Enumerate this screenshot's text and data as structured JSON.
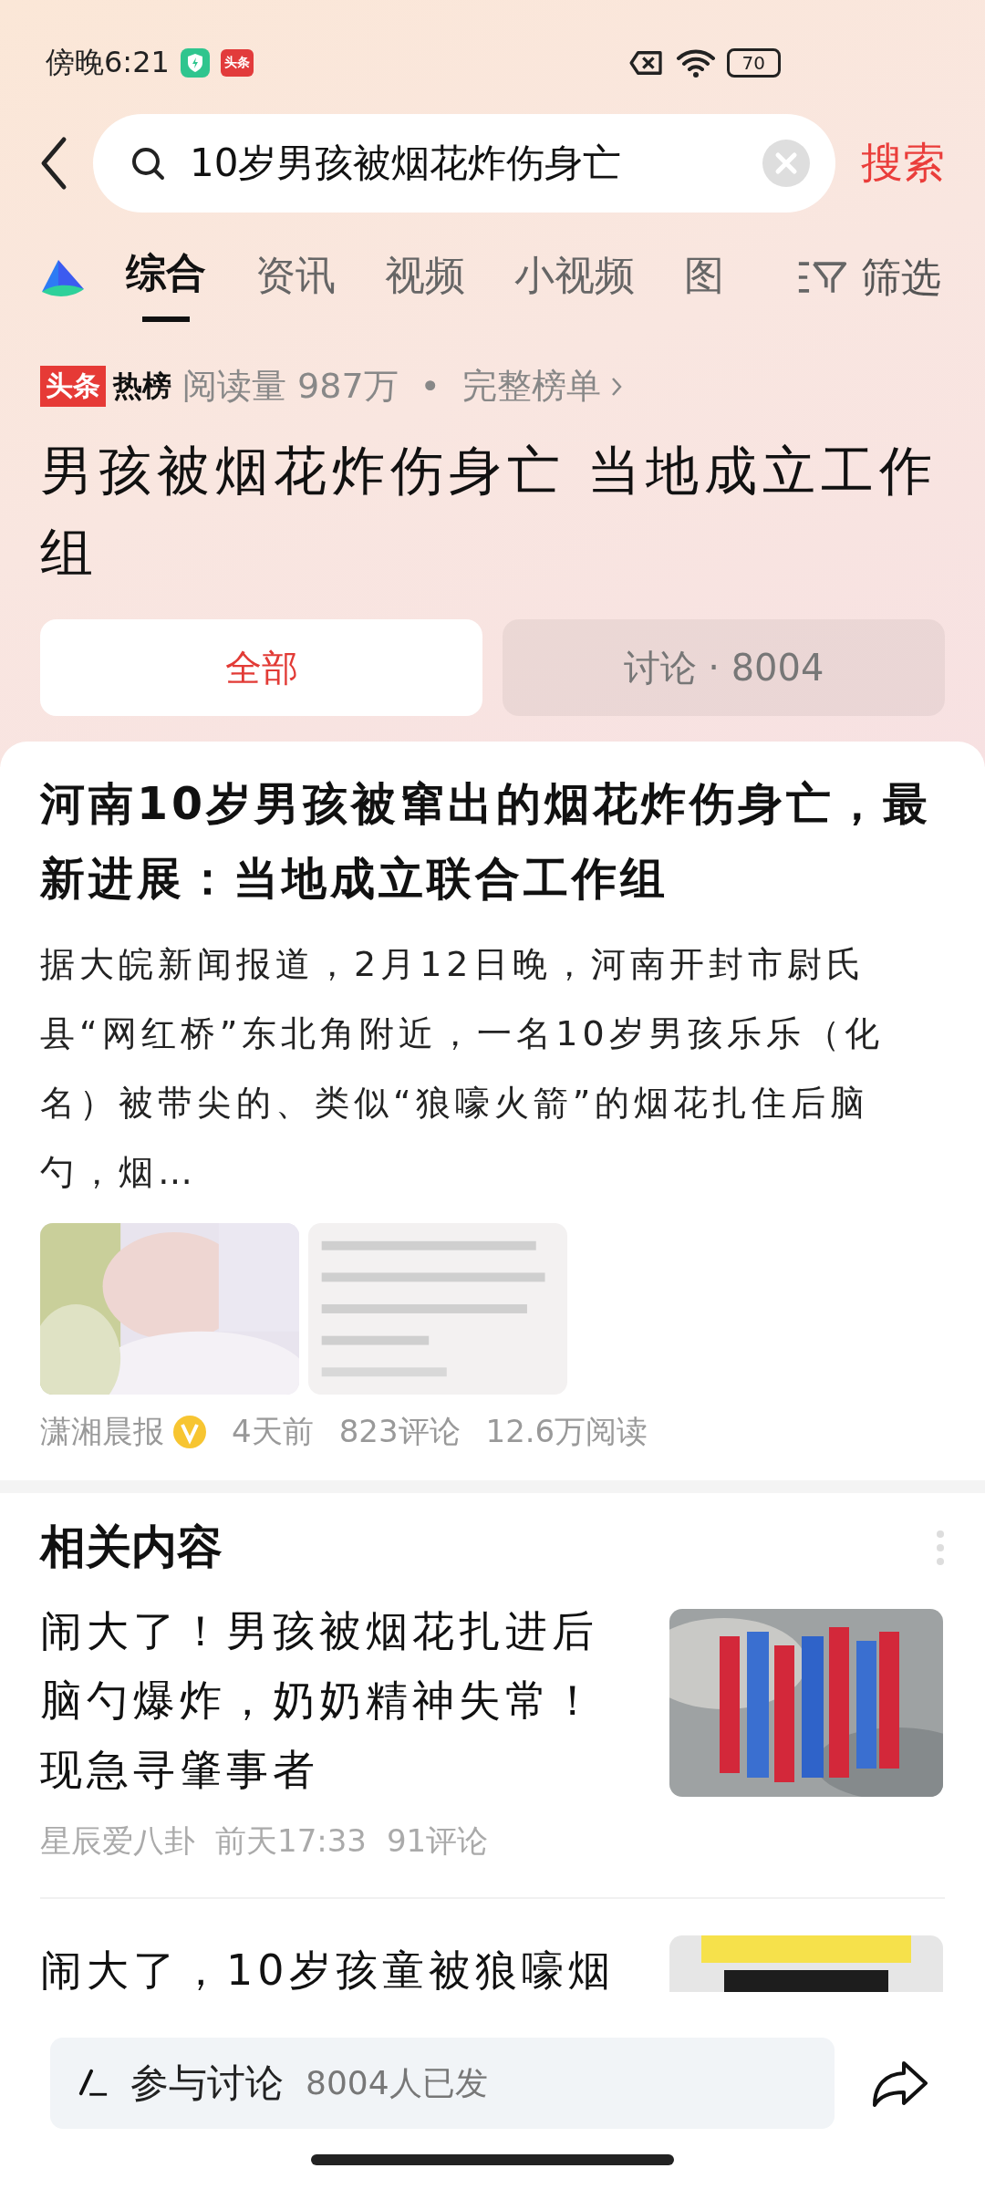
{
  "status_bar": {
    "time": "傍晚6:21",
    "app_badge": "头条",
    "battery": "70"
  },
  "search": {
    "value": "10岁男孩被烟花炸伤身亡",
    "submit": "搜索"
  },
  "tabs": [
    {
      "label": "综合",
      "selected": true
    },
    {
      "label": "资讯",
      "selected": false
    },
    {
      "label": "视频",
      "selected": false
    },
    {
      "label": "小视频",
      "selected": false
    },
    {
      "label": "图",
      "selected": false
    }
  ],
  "filter": {
    "label": "筛选"
  },
  "hot": {
    "brand_left": "头条",
    "brand_right": "热榜",
    "reads": "阅读量 987万",
    "separator": "•",
    "full_list": "完整榜单",
    "title": "男孩被烟花炸伤身亡 当地成立工作组"
  },
  "segments": [
    {
      "label": "全部",
      "selected": true
    },
    {
      "label": "讨论 · 8004",
      "selected": false
    }
  ],
  "article": {
    "title": "河南10岁男孩被窜出的烟花炸伤身亡，最新进展：当地成立联合工作组",
    "summary": "据大皖新闻报道，2月12日晚，河南开封市尉氏县“网红桥”东北角附近，一名10岁男孩乐乐（化名）被带尖的、类似“狼嚎火箭”的烟花扎住后脑勺，烟…",
    "source": "潇湘晨报",
    "verified": true,
    "time": "4天前",
    "comments": "823评论",
    "reads": "12.6万阅读"
  },
  "related": {
    "heading": "相关内容",
    "items": [
      {
        "title": "闹大了！男孩被烟花扎进后脑勺爆炸，奶奶精神失常！现急寻肇事者",
        "source": "星辰爱八卦",
        "time": "前天17:33",
        "comments": "91评论"
      },
      {
        "title": "闹大了，10岁孩童被狼嚎烟"
      }
    ]
  },
  "bottom_bar": {
    "placeholder": "参与讨论",
    "count": "8004人已发"
  }
}
